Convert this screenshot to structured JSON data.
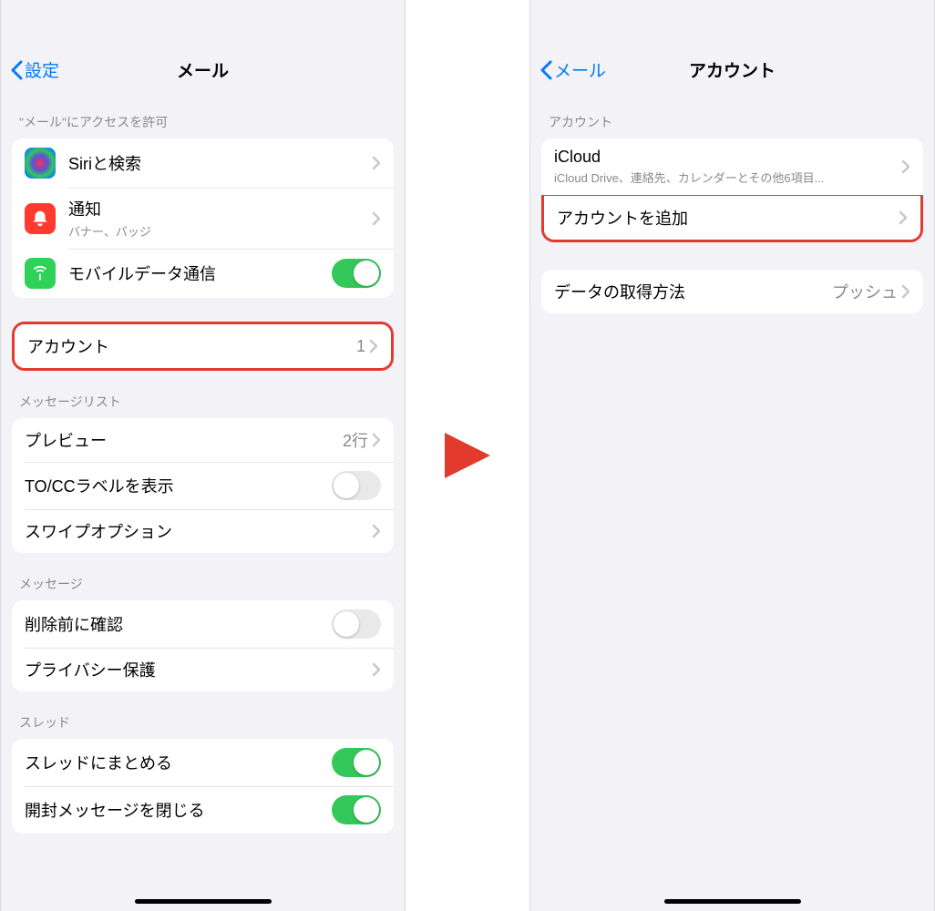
{
  "left": {
    "back": "設定",
    "title": "メール",
    "section_access": "\"メール\"にアクセスを許可",
    "rows_access": {
      "siri": "Siriと検索",
      "notif": "通知",
      "notif_sub": "バナー、バッジ",
      "cellular": "モバイルデータ通信"
    },
    "accounts": {
      "label": "アカウント",
      "count": "1"
    },
    "section_msglist": "メッセージリスト",
    "rows_msglist": {
      "preview": "プレビュー",
      "preview_value": "2行",
      "tocc": "TO/CCラベルを表示",
      "swipe": "スワイプオプション"
    },
    "section_msg": "メッセージ",
    "rows_msg": {
      "ask_delete": "削除前に確認",
      "privacy": "プライバシー保護"
    },
    "section_thread": "スレッド",
    "rows_thread": {
      "organize": "スレッドにまとめる",
      "collapse_read": "開封メッセージを閉じる"
    }
  },
  "right": {
    "back": "メール",
    "title": "アカウント",
    "section_accounts": "アカウント",
    "icloud": {
      "label": "iCloud",
      "sub": "iCloud Drive、連絡先、カレンダーとその他6項目..."
    },
    "add_account": "アカウントを追加",
    "fetch": {
      "label": "データの取得方法",
      "value": "プッシュ"
    }
  }
}
